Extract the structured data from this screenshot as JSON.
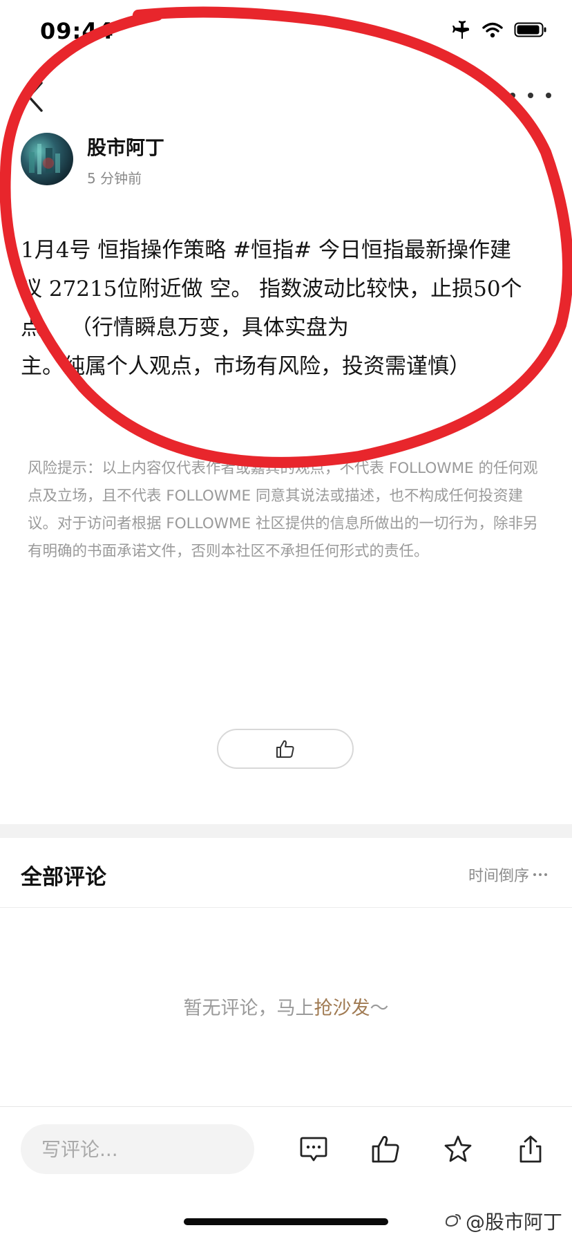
{
  "status_bar": {
    "time": "09:44",
    "icons": [
      "airplane-icon",
      "wifi-icon",
      "battery-icon"
    ]
  },
  "nav": {
    "back_icon": "chevron-left-icon",
    "more_icon": "more-horizontal-icon"
  },
  "author": {
    "name": "股市阿丁",
    "time_ago": "5 分钟前"
  },
  "post": {
    "lines": [
      "1月4号  恒指操作策略 #恒指# 今日恒指最新操作建",
      "议 27215位附近做 空。  指数波动比较快，止损50个",
      "点。                     （行情瞬息万变，具体实盘为",
      "主。纯属个人观点，市场有风险，投资需谨慎）"
    ]
  },
  "disclaimer": {
    "text": "风险提示：以上内容仅代表作者或嘉宾的观点，不代表 FOLLOWME 的任何观点及立场，且不代表 FOLLOWME 同意其说法或描述，也不构成任何投资建议。对于访问者根据 FOLLOWME 社区提供的信息所做出的一切行为，除非另有明确的书面承诺文件，否则本社区不承担任何形式的责任。"
  },
  "comments": {
    "title": "全部评论",
    "sort_label": "时间倒序",
    "empty_prefix": "暂无评论，马上",
    "empty_link": "抢沙发",
    "empty_suffix": "～"
  },
  "bottom_bar": {
    "input_placeholder": "写评论...",
    "icons": [
      "comment-icon",
      "thumbs-up-icon",
      "star-icon",
      "share-icon"
    ]
  },
  "watermark": {
    "text": "@股市阿丁"
  },
  "colors": {
    "annotation_red": "#e8262c",
    "link_brown": "#a07a52",
    "muted_text": "#9a9a9a"
  }
}
